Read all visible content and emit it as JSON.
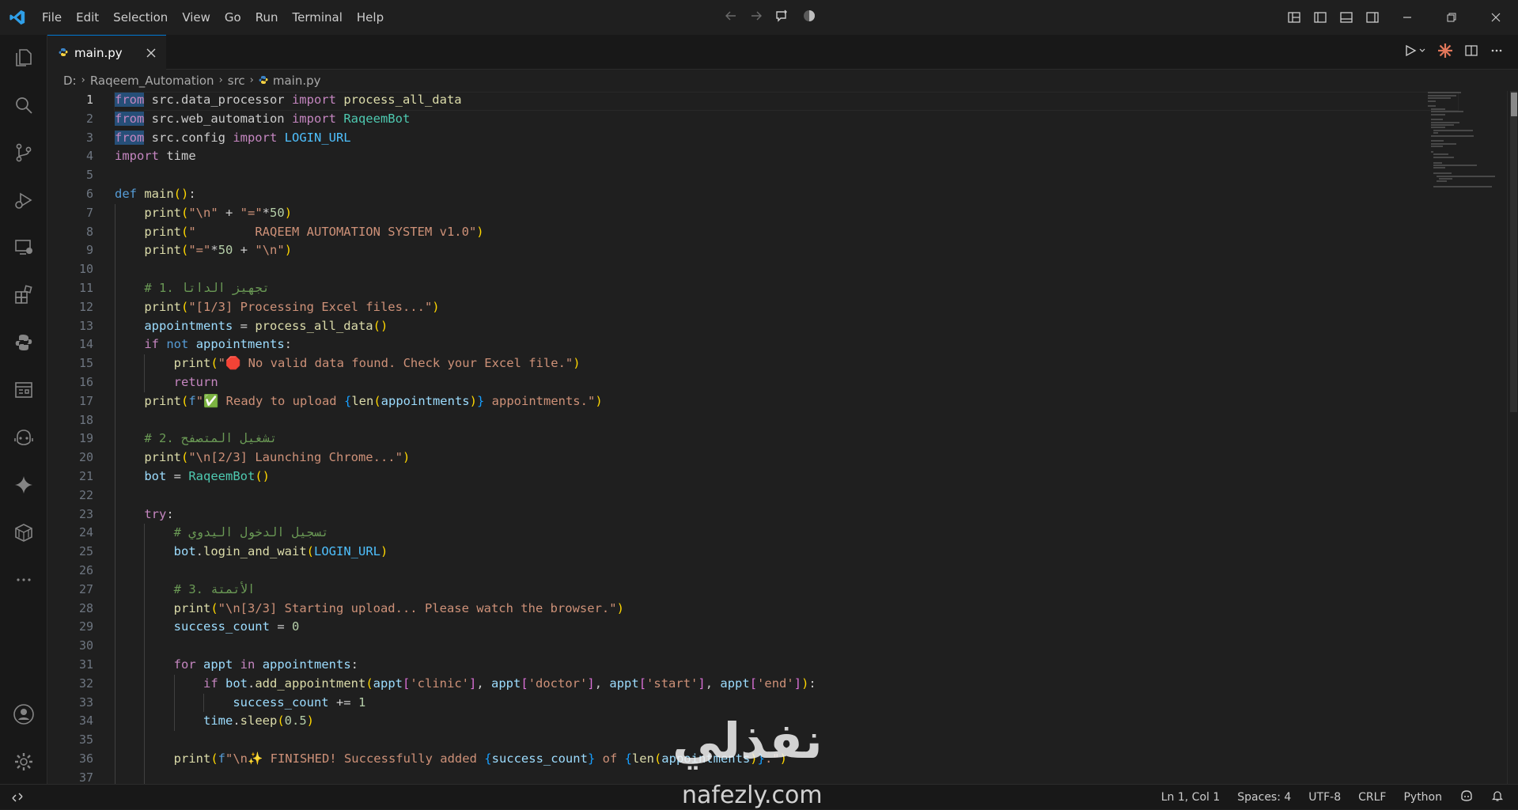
{
  "menu": [
    "File",
    "Edit",
    "Selection",
    "View",
    "Go",
    "Run",
    "Terminal",
    "Help"
  ],
  "tab": {
    "name": "main.py"
  },
  "breadcrumb": {
    "drive": "D:",
    "folder": "Raqeem_Automation",
    "subfolder": "src",
    "file": "main.py"
  },
  "cursor_line": 1,
  "lines": [
    "from src.data_processor import process_all_data",
    "from src.web_automation import RaqeemBot",
    "from src.config import LOGIN_URL",
    "import time",
    "",
    "def main():",
    "    print(\"\\n\" + \"=\"*50)",
    "    print(\"        RAQEEM AUTOMATION SYSTEM v1.0\")",
    "    print(\"=\"*50 + \"\\n\")",
    "",
    "    # 1. تجهيز الداتا",
    "    print(\"[1/3] Processing Excel files...\")",
    "    appointments = process_all_data()",
    "    if not appointments:",
    "        print(\"🛑 No valid data found. Check your Excel file.\")",
    "        return",
    "    print(f\"✅ Ready to upload {len(appointments)} appointments.\")",
    "",
    "    # 2. تشغيل المتصفح",
    "    print(\"\\n[2/3] Launching Chrome...\")",
    "    bot = RaqeemBot()",
    "",
    "    try:",
    "        # تسجيل الدخول اليدوي",
    "        bot.login_and_wait(LOGIN_URL)",
    "",
    "        # 3. الأتمتة",
    "        print(\"\\n[3/3] Starting upload... Please watch the browser.\")",
    "        success_count = 0",
    "",
    "        for appt in appointments:",
    "            if bot.add_appointment(appt['clinic'], appt['doctor'], appt['start'], appt['end']):",
    "                success_count += 1",
    "            time.sleep(0.5)",
    "",
    "        print(f\"\\n✨ FINISHED! Successfully added {success_count} of {len(appointments)}.\")",
    ""
  ],
  "status": {
    "position": "Ln 1, Col 1",
    "spaces": "Spaces: 4",
    "encoding": "UTF-8",
    "eol": "CRLF",
    "language": "Python"
  },
  "watermark": {
    "arabic": "نفذلي",
    "latin": "nafezly.com"
  },
  "colors": {
    "accent": "#0078d4",
    "keyword": "#c586c0",
    "string": "#ce9178",
    "function": "#dcdcaa",
    "comment": "#6a9955"
  }
}
